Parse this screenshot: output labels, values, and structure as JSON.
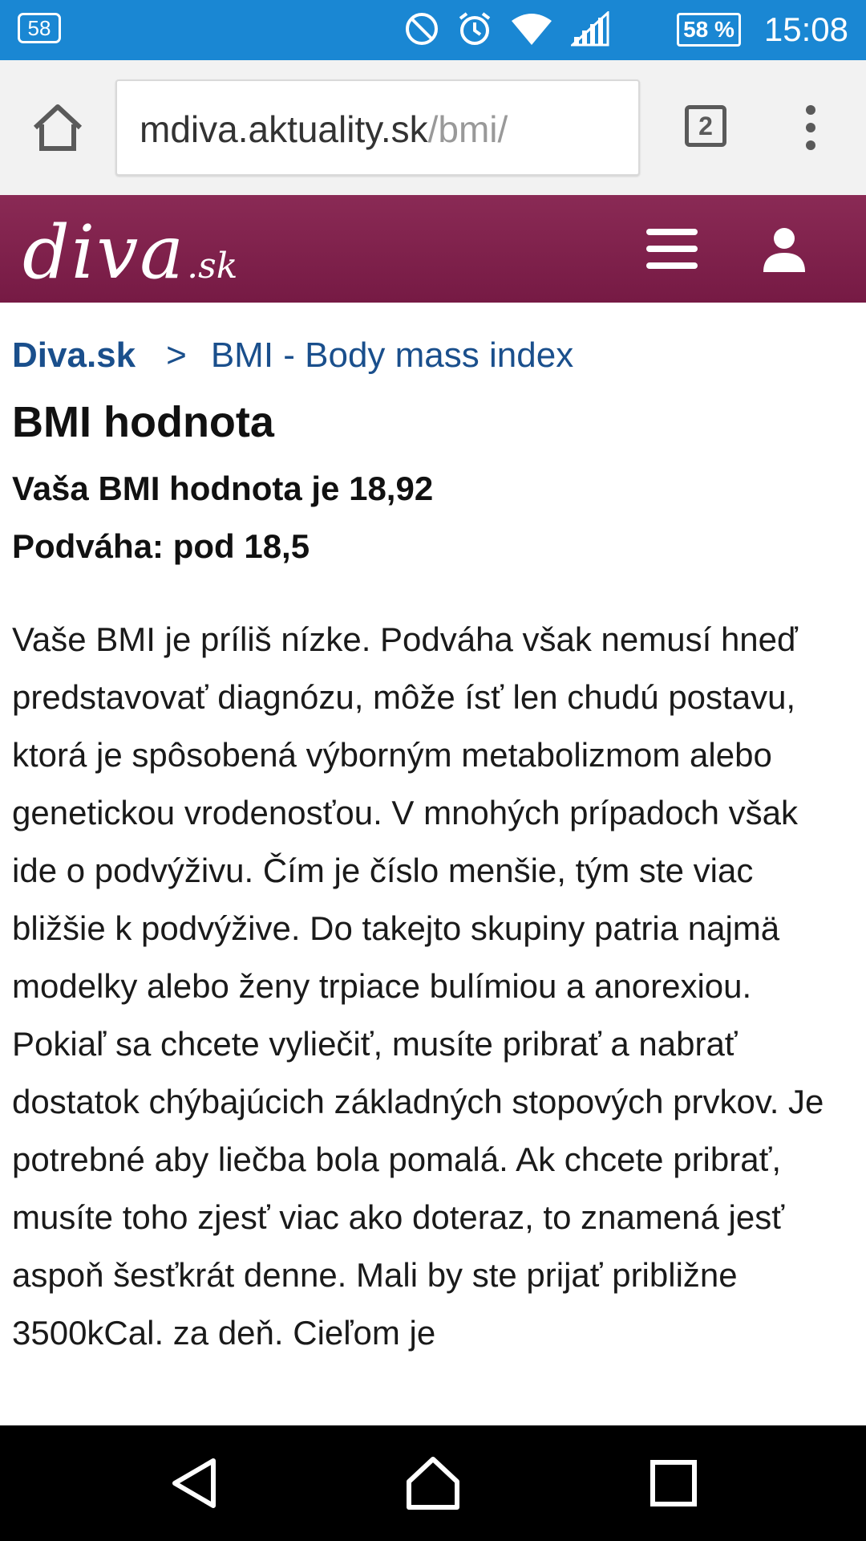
{
  "status_bar": {
    "notification_badge": "58",
    "battery_text": "58 %",
    "battery_level": 0.58,
    "time": "15:08",
    "icons": [
      "dnd-icon",
      "alarm-icon",
      "wifi-icon",
      "signal-icon"
    ]
  },
  "browser": {
    "url_domain": "mdiva.aktuality.sk",
    "url_path": "/bmi/",
    "tabs_count": "2"
  },
  "site": {
    "logo_main": "diva",
    "logo_tld": ".sk",
    "brand_color": "#7d1f4a"
  },
  "breadcrumb": {
    "home": "Diva.sk",
    "separator": ">",
    "current": "BMI - Body mass index"
  },
  "page": {
    "title": "BMI hodnota",
    "result_value": "Vaša BMI hodnota je 18,92",
    "category": "Podváha: pod 18,5",
    "body": "Vaše BMI je príliš nízke. Podváha však nemusí hneď predstavovať diagnózu, môže ísť len chudú postavu, ktorá je spôsobená výborným metabolizmom alebo genetickou vrodenosťou. V mnohých prípadoch však ide o podvýživu. Čím je číslo menšie, tým ste viac bližšie k podvýžive. Do takejto skupiny patria najmä modelky alebo ženy trpiace bulímiou a anorexiou. Pokiaľ sa chcete vyliečiť, musíte pribrať a nabrať dostatok chýbajúcich základných stopových prvkov. Je potrebné aby liečba bola pomalá. Ak chcete pribrať, musíte toho zjesť viac ako doteraz, to znamená jesť aspoň šesťkrát denne. Mali by ste prijať približne 3500kCal. za deň. Cieľom je"
  }
}
